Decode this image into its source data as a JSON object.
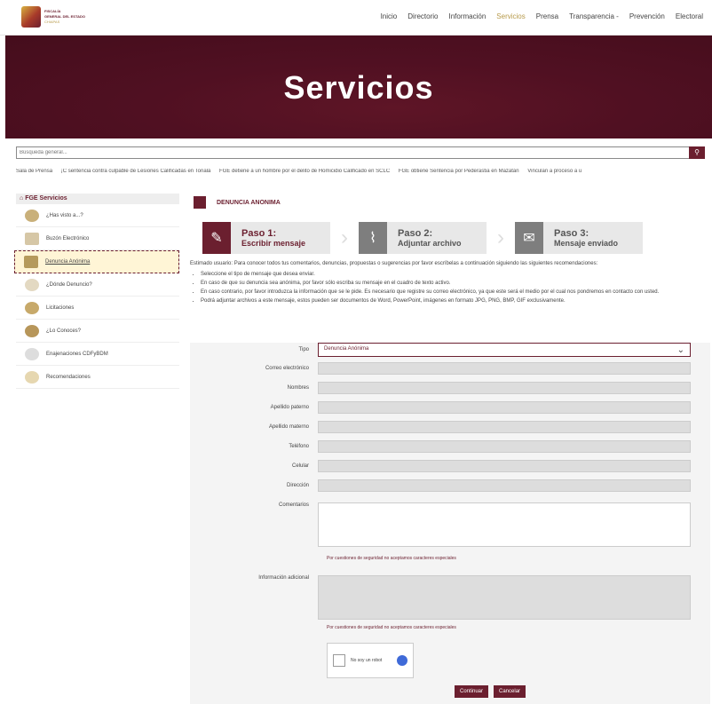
{
  "header": {
    "logo_line1": "FISCALÍA",
    "logo_line2": "GENERAL DEL ESTADO",
    "logo_line3": "CHIAPAS",
    "nav": [
      "Inicio",
      "Directorio",
      "Información",
      "Servicios",
      "Prensa",
      "Transparencia -",
      "Prevención",
      "Electoral"
    ],
    "active_nav": "Servicios"
  },
  "banner": {
    "title": "Servicios"
  },
  "search": {
    "placeholder": "Búsqueda general..."
  },
  "ticker": [
    "Sala de Prensa",
    "¡C sentencia contra culpable de Lesiones Calificadas en Tonalá",
    "FGE detiene a un hombre por el delito de Homicidio Calificado en SCLC",
    "FGE obtiene Sentencia por Pederastia en Mazatán",
    "Vinculan a proceso a u"
  ],
  "sidebar": {
    "title": "FGE Servicios",
    "items": [
      {
        "label": "¿Has visto a...?"
      },
      {
        "label": "Buzón Electrónico"
      },
      {
        "label": "Denuncia Anónima"
      },
      {
        "label": "¿Dónde Denuncio?"
      },
      {
        "label": "Licitaciones"
      },
      {
        "label": "¿Lo Conoces?"
      },
      {
        "label": "Enajenaciones CDFyBDM"
      },
      {
        "label": "Recomendaciones"
      }
    ]
  },
  "main": {
    "title": "DENUNCIA ANONIMA",
    "steps": [
      {
        "n": "Paso 1:",
        "d": "Escribir mensaje"
      },
      {
        "n": "Paso 2:",
        "d": "Adjuntar archivo"
      },
      {
        "n": "Paso 3:",
        "d": "Mensaje enviado"
      }
    ],
    "intro": "Estimado usuario: Para conocer todos tus comentarios, denuncias, propuestas o sugerencias por favor escríbelas a continuación siguiendo las siguientes recomendaciones:",
    "bullets": [
      "Seleccione el tipo de mensaje que desea enviar.",
      "En caso de que su denuncia sea anónima, por favor sólo escriba su mensaje en el cuadro de texto activo.",
      "En caso contrario, por favor introduzca la información que se le pide. Es necesario que registre su correo electrónico, ya que este será el medio por el cual nos pondremos en contacto con usted.",
      "Podrá adjuntar archivos a este mensaje, estos pueden ser documentos de Word, PowerPoint, imágenes en formato JPG, PNG, BMP, GIF exclusivamente."
    ]
  },
  "form": {
    "tipo_label": "Tipo",
    "tipo_value": "Denuncia Anónima",
    "correo_label": "Correo electrónico",
    "nombres_label": "Nombres",
    "apellido_paterno_label": "Apellido paterno",
    "apellido_materno_label": "Apellido materno",
    "telefono_label": "Teléfono",
    "celular_label": "Celular",
    "direccion_label": "Dirección",
    "comentarios_label": "Comentarios",
    "hint1": "Por cuestiones de seguridad no aceptamos caracteres especiales",
    "info_label": "Información adicional",
    "hint2": "Por cuestiones de seguridad no aceptamos caracteres especiales",
    "captcha_label": "No soy un robot",
    "continuar": "Continuar",
    "cancelar": "Cancelar"
  }
}
